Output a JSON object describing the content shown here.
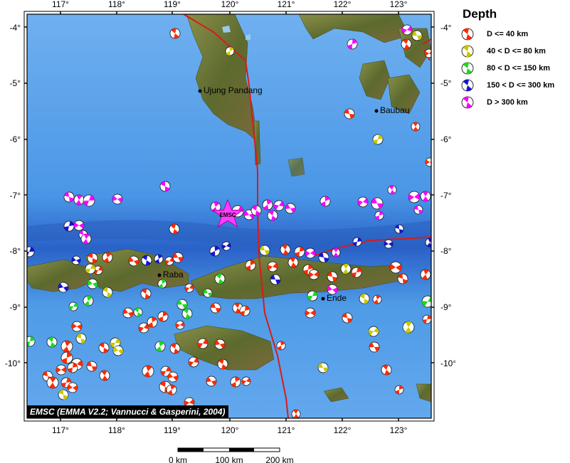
{
  "map": {
    "lon_ticks": [
      "117°",
      "118°",
      "119°",
      "120°",
      "121°",
      "122°",
      "123°"
    ],
    "lat_ticks": [
      "-4°",
      "-5°",
      "-6°",
      "-7°",
      "-8°",
      "-9°",
      "-10°"
    ],
    "places": [
      {
        "name": "Ujung Pandang"
      },
      {
        "name": "Baubau"
      },
      {
        "name": "Raba"
      },
      {
        "name": "Ende"
      }
    ],
    "epicenter_label": "EMSC",
    "credit": "EMSC (EMMA V2.2; Vannucci & Gasperini, 2004)"
  },
  "legend": {
    "title": "Depth",
    "items": [
      {
        "label": "D <= 40 km",
        "color": "#ff2a00"
      },
      {
        "label": "40 < D <= 80 km",
        "color": "#c8c800"
      },
      {
        "label": "80 < D <= 150 km",
        "color": "#1ed81e"
      },
      {
        "label": "150 < D <= 300 km",
        "color": "#1414d2"
      },
      {
        "label": "D > 300 km",
        "color": "#ff00ff"
      }
    ]
  },
  "scale_bar": {
    "labels": [
      "0 km",
      "100 km",
      "200 km"
    ]
  },
  "colors": {
    "sea": "#4d9ae8",
    "deep_sea": "#2f6fcf",
    "land": "#6e7a3a",
    "plate_boundary": "#d81b1b",
    "epicenter": "#ff33ff"
  }
}
